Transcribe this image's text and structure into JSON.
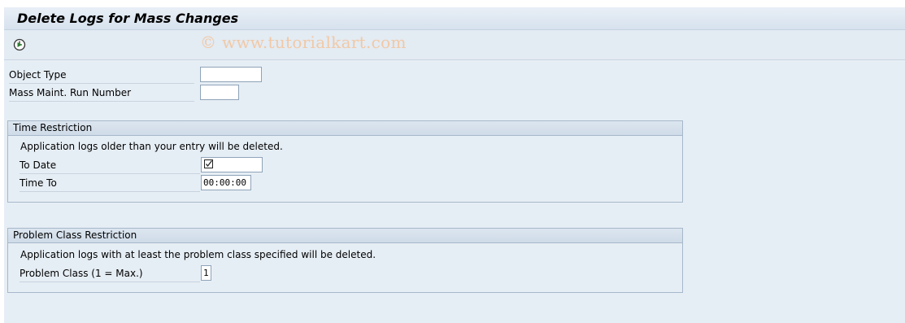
{
  "window": {
    "title": "Delete Logs for Mass Changes"
  },
  "toolbar": {
    "execute_icon": "execute-icon",
    "watermark": "© www.tutorialkart.com"
  },
  "fields": {
    "object_type": {
      "label": "Object Type",
      "value": ""
    },
    "run_number": {
      "label": "Mass Maint. Run Number",
      "value": ""
    }
  },
  "time_restriction": {
    "title": "Time Restriction",
    "note": "Application logs older than your entry will be deleted.",
    "to_date": {
      "label": "To Date",
      "value": ""
    },
    "time_to": {
      "label": "Time To",
      "value": "00:00:00"
    }
  },
  "problem_class_restriction": {
    "title": "Problem Class Restriction",
    "note": "Application logs with at least the problem class specified will be deleted.",
    "problem_class": {
      "label": "Problem Class (1 = Max.)",
      "value": "1"
    }
  },
  "colors": {
    "background": "#e6eef5",
    "group_border": "#a7b8ca",
    "watermark": "#f1c9a6"
  }
}
